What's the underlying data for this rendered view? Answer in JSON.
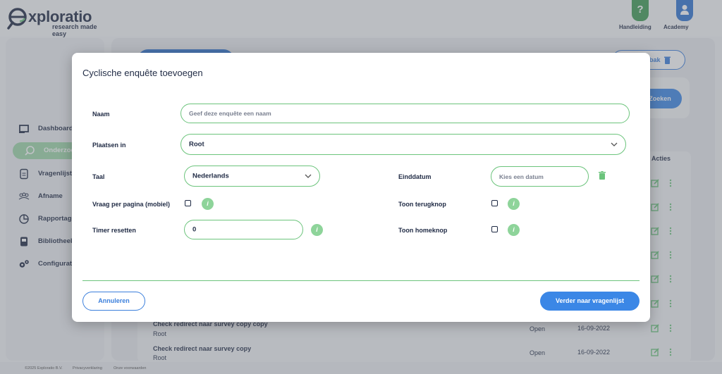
{
  "app": {
    "logo_word": "xploratio",
    "logo_tagline": "research made easy",
    "help_links": [
      {
        "label": "Handleiding",
        "icon": "question-icon",
        "glyph": "?"
      },
      {
        "label": "Academy",
        "icon": "user-icon",
        "glyph": ""
      }
    ]
  },
  "sidebar": {
    "items": [
      {
        "label": "Dashboard",
        "icon": "dashboard-icon"
      },
      {
        "label": "Onderzoek",
        "icon": "search-icon"
      },
      {
        "label": "Vragenlijst",
        "icon": "document-icon"
      },
      {
        "label": "Afname",
        "icon": "users-icon"
      },
      {
        "label": "Rapportage",
        "icon": "pie-chart-icon"
      },
      {
        "label": "Bibliotheek",
        "icon": "library-icon"
      },
      {
        "label": "Configuratie",
        "icon": "gears-icon"
      }
    ]
  },
  "background": {
    "trash_button": "bak",
    "search_button": "Zoeken",
    "actions_header": "Acties",
    "rows": [
      {
        "title": "Check redirect naar survey copy copy",
        "folder": "Root",
        "status": "Open",
        "date": "16-09-2022"
      },
      {
        "title": "Check redirect naar survey copy",
        "folder": "Root",
        "status": "Open",
        "date": "16-09-2022"
      }
    ]
  },
  "footer": {
    "copyright": "©2025 Exploratio B.V.",
    "privacy": "Privacyverklaring",
    "terms": "Onze voorwaarden"
  },
  "modal": {
    "title": "Cyclische enquête toevoegen",
    "name": {
      "label": "Naam",
      "placeholder": "Geef deze enquête een naam"
    },
    "location": {
      "label": "Plaatsen in",
      "value": "Root"
    },
    "language": {
      "label": "Taal",
      "value": "Nederlands"
    },
    "end_date": {
      "label": "Einddatum",
      "placeholder": "Kies een datum"
    },
    "question_per_page": {
      "label": "Vraag per pagina (mobiel)",
      "checked": false
    },
    "show_back": {
      "label": "Toon terugknop",
      "checked": false
    },
    "timer_reset": {
      "label": "Timer resetten",
      "value": "0"
    },
    "show_home": {
      "label": "Toon homeknop",
      "checked": false
    },
    "info_glyph": "i",
    "cancel_label": "Annuleren",
    "next_label": "Verder naar vragenlijst"
  },
  "colors": {
    "accent_green": "#6cc47c",
    "info_green": "#8ed49a",
    "primary_blue": "#3b87e6",
    "text_navy": "#1f2a44"
  }
}
